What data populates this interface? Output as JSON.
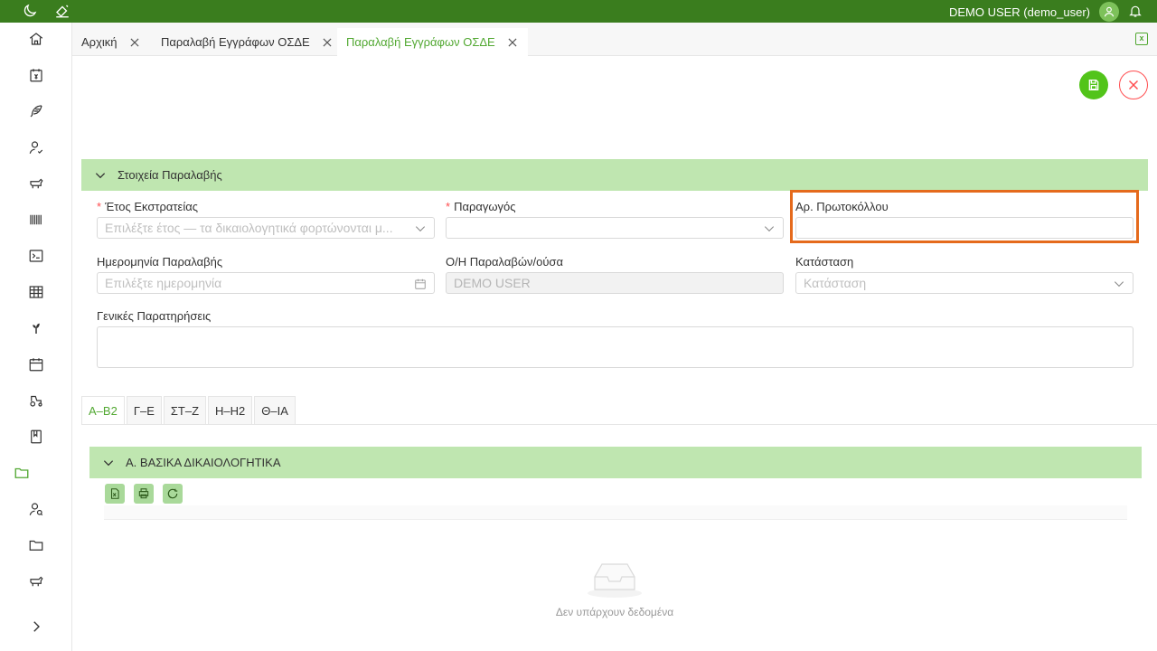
{
  "header": {
    "user": "DEMO USER (demo_user)"
  },
  "icons": [
    "moon-icon",
    "brush-icon",
    "user-icon",
    "bell-icon",
    "home-icon",
    "calendar-money-icon",
    "feather-icon",
    "user-check-icon",
    "cow-icon",
    "barcode-icon",
    "terminal-icon",
    "table-icon",
    "plant-icon",
    "calendar-icon",
    "tractor-icon",
    "book-icon",
    "folder-icon",
    "user-search-icon",
    "folder-icon",
    "cow-icon",
    "chevron-right-icon"
  ],
  "tabs": [
    {
      "label": "Αρχική"
    },
    {
      "label": "Παραλαβή Εγγράφων ΟΣΔΕ"
    },
    {
      "label": "Παραλαβή Εγγράφων ΟΣΔΕ"
    }
  ],
  "section": {
    "title": "Στοιχεία Παραλαβής"
  },
  "form": {
    "year_label": "Έτος Εκστρατείας",
    "year_placeholder": "Επιλέξτε έτος — τα δικαιολογητικά φορτώνονται μ...",
    "producer_label": "Παραγωγός",
    "producer_value": "",
    "protocol_label": "Αρ. Πρωτοκόλλου",
    "protocol_value": "",
    "date_label": "Ημερομηνία Παραλαβής",
    "date_placeholder": "Επιλέξτε ημερομηνία",
    "receiver_label": "Ο/Η Παραλαβών/ούσα",
    "receiver_value": "DEMO  USER",
    "status_label": "Κατάσταση",
    "status_placeholder": "Κατάσταση",
    "notes_label": "Γενικές Παρατηρήσεις",
    "required_mark": "*"
  },
  "subtabs": [
    {
      "label": "Α–Β2"
    },
    {
      "label": "Γ–Ε"
    },
    {
      "label": "ΣΤ–Ζ"
    },
    {
      "label": "Η–Η2"
    },
    {
      "label": "Θ–ΙΑ"
    }
  ],
  "docs_section": {
    "title": "Α. ΒΑΣΙΚΑ ΔΙΚΑΙΟΛΟΓΗΤΙΚΑ"
  },
  "empty_state": {
    "text": "Δεν υπάρχουν δεδομένα"
  },
  "colors": {
    "brand": "#3a7d1e",
    "accent": "#52a832",
    "section": "#bfe6b0",
    "danger": "#ff4d4f",
    "highlight": "#e56a1c"
  }
}
